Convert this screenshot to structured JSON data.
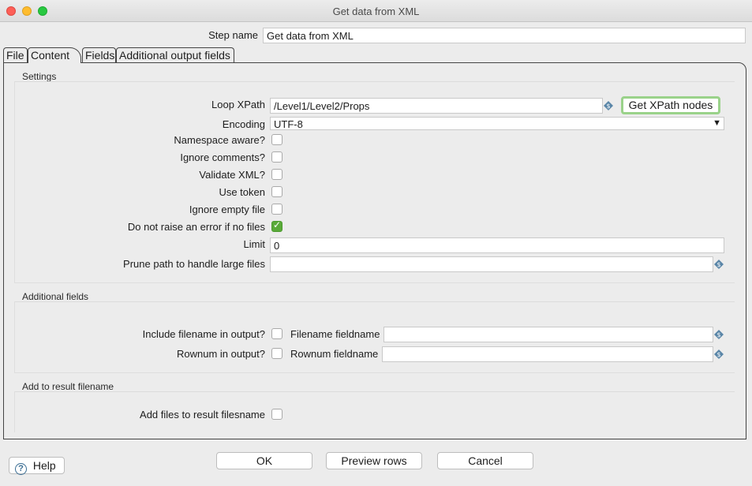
{
  "window": {
    "title": "Get data from XML"
  },
  "step": {
    "label": "Step name",
    "value": "Get data from XML"
  },
  "tabs": [
    {
      "label": "File"
    },
    {
      "label": "Content"
    },
    {
      "label": "Fields"
    },
    {
      "label": "Additional output fields"
    }
  ],
  "settings": {
    "title": "Settings",
    "loop_xpath_label": "Loop XPath",
    "loop_xpath_value": "/Level1/Level2/Props",
    "get_xpath_button": "Get XPath nodes",
    "encoding_label": "Encoding",
    "encoding_value": "UTF-8",
    "namespace_label": "Namespace aware?",
    "ignore_comments_label": "Ignore comments?",
    "validate_label": "Validate XML?",
    "use_token_label": "Use token",
    "ignore_empty_label": "Ignore empty file",
    "no_error_label": "Do not raise an error if no files",
    "limit_label": "Limit",
    "limit_value": "0",
    "prune_label": "Prune path to handle large files",
    "prune_value": ""
  },
  "additional": {
    "title": "Additional fields",
    "include_filename_label": "Include filename in output?",
    "filename_fieldname_label": "Filename fieldname",
    "rownum_label": "Rownum in output?",
    "rownum_fieldname_label": "Rownum fieldname"
  },
  "result": {
    "title": "Add to result filename",
    "add_files_label": "Add files to result filesname"
  },
  "footer": {
    "help": "Help",
    "ok": "OK",
    "preview": "Preview rows",
    "cancel": "Cancel"
  }
}
